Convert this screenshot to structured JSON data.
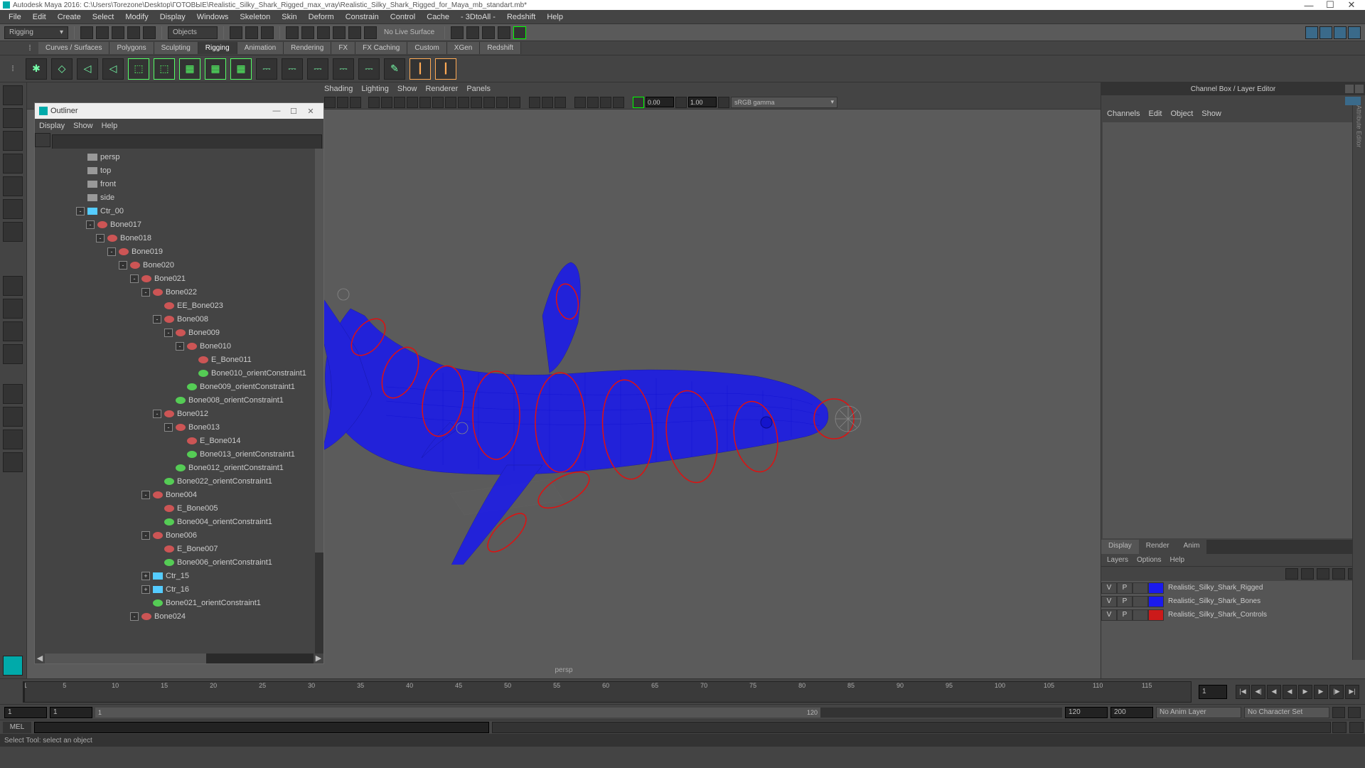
{
  "titlebar": {
    "text": "Autodesk Maya 2016: C:\\Users\\Torezone\\Desktop\\ГОТОВЫЕ\\Realistic_Silky_Shark_Rigged_max_vray\\Realistic_Silky_Shark_Rigged_for_Maya_mb_standart.mb*"
  },
  "mainmenu": [
    "File",
    "Edit",
    "Create",
    "Select",
    "Modify",
    "Display",
    "Windows",
    "Skeleton",
    "Skin",
    "Deform",
    "Constrain",
    "Control",
    "Cache",
    "- 3DtoAll -",
    "Redshift",
    "Help"
  ],
  "shelf": {
    "dropdown": "Rigging",
    "objectsLabel": "Objects",
    "noLiveSurface": "No Live Surface"
  },
  "tabs": [
    "Curves / Surfaces",
    "Polygons",
    "Sculpting",
    "Rigging",
    "Animation",
    "Rendering",
    "FX",
    "FX Caching",
    "Custom",
    "XGen",
    "Redshift"
  ],
  "activeTab": "Rigging",
  "outliner": {
    "title": "Outliner",
    "menu": [
      "Display",
      "Show",
      "Help"
    ],
    "tree": [
      {
        "ind": 0,
        "type": "cam",
        "label": "persp",
        "exp": false
      },
      {
        "ind": 0,
        "type": "cam",
        "label": "top",
        "exp": false
      },
      {
        "ind": 0,
        "type": "cam",
        "label": "front",
        "exp": false
      },
      {
        "ind": 0,
        "type": "cam",
        "label": "side",
        "exp": false
      },
      {
        "ind": 0,
        "type": "ctrl",
        "label": "Ctr_00",
        "exp": "-",
        "preExp": true
      },
      {
        "ind": 1,
        "type": "bone",
        "label": "Bone017",
        "exp": "-",
        "preExp": true
      },
      {
        "ind": 2,
        "type": "bone",
        "label": "Bone018",
        "exp": "-",
        "preExp": true
      },
      {
        "ind": 3,
        "type": "bone",
        "label": "Bone019",
        "exp": "-",
        "preExp": true
      },
      {
        "ind": 4,
        "type": "bone",
        "label": "Bone020",
        "exp": "-",
        "preExp": true
      },
      {
        "ind": 5,
        "type": "bone",
        "label": "Bone021",
        "exp": "-",
        "preExp": true
      },
      {
        "ind": 6,
        "type": "bone",
        "label": "Bone022",
        "exp": "-",
        "preExp": true
      },
      {
        "ind": 7,
        "type": "bone",
        "label": "EE_Bone023"
      },
      {
        "ind": 7,
        "type": "bone",
        "label": "Bone008",
        "exp": "-",
        "preExp": true
      },
      {
        "ind": 8,
        "type": "bone",
        "label": "Bone009",
        "exp": "-",
        "preExp": true
      },
      {
        "ind": 9,
        "type": "bone",
        "label": "Bone010",
        "exp": "-",
        "preExp": true
      },
      {
        "ind": 10,
        "type": "bone",
        "label": "E_Bone011"
      },
      {
        "ind": 10,
        "type": "constraint",
        "label": "Bone010_orientConstraint1"
      },
      {
        "ind": 9,
        "type": "constraint",
        "label": "Bone009_orientConstraint1"
      },
      {
        "ind": 8,
        "type": "constraint",
        "label": "Bone008_orientConstraint1"
      },
      {
        "ind": 7,
        "type": "bone",
        "label": "Bone012",
        "exp": "-",
        "preExp": true
      },
      {
        "ind": 8,
        "type": "bone",
        "label": "Bone013",
        "exp": "-",
        "preExp": true
      },
      {
        "ind": 9,
        "type": "bone",
        "label": "E_Bone014"
      },
      {
        "ind": 9,
        "type": "constraint",
        "label": "Bone013_orientConstraint1"
      },
      {
        "ind": 8,
        "type": "constraint",
        "label": "Bone012_orientConstraint1"
      },
      {
        "ind": 7,
        "type": "constraint",
        "label": "Bone022_orientConstraint1"
      },
      {
        "ind": 6,
        "type": "bone",
        "label": "Bone004",
        "exp": "-",
        "preExp": true
      },
      {
        "ind": 7,
        "type": "bone",
        "label": "E_Bone005"
      },
      {
        "ind": 7,
        "type": "constraint",
        "label": "Bone004_orientConstraint1"
      },
      {
        "ind": 6,
        "type": "bone",
        "label": "Bone006",
        "exp": "-",
        "preExp": true
      },
      {
        "ind": 7,
        "type": "bone",
        "label": "E_Bone007"
      },
      {
        "ind": 7,
        "type": "constraint",
        "label": "Bone006_orientConstraint1"
      },
      {
        "ind": 6,
        "type": "ctrl",
        "label": "Ctr_15",
        "exp": "+"
      },
      {
        "ind": 6,
        "type": "ctrl",
        "label": "Ctr_16",
        "exp": "+"
      },
      {
        "ind": 6,
        "type": "constraint",
        "label": "Bone021_orientConstraint1"
      },
      {
        "ind": 5,
        "type": "bone",
        "label": "Bone024",
        "exp": "-",
        "preExp": true
      }
    ]
  },
  "viewport": {
    "menu": [
      "Shading",
      "Lighting",
      "Show",
      "Renderer",
      "Panels"
    ],
    "val1": "0.00",
    "val2": "1.00",
    "colorspace": "sRGB gamma",
    "label": "persp"
  },
  "channelbox": {
    "title": "Channel Box / Layer Editor",
    "menu": [
      "Channels",
      "Edit",
      "Object",
      "Show"
    ],
    "tabs": [
      "Display",
      "Render",
      "Anim"
    ],
    "activeTab": "Display",
    "menu2": [
      "Layers",
      "Options",
      "Help"
    ],
    "layers": [
      {
        "v": "V",
        "p": "P",
        "color": "#1a1aee",
        "name": "Realistic_Silky_Shark_Rigged"
      },
      {
        "v": "V",
        "p": "P",
        "color": "#1a1aee",
        "name": "Realistic_Silky_Shark_Bones"
      },
      {
        "v": "V",
        "p": "P",
        "color": "#cc1a1a",
        "name": "Realistic_Silky_Shark_Controls"
      }
    ]
  },
  "timeline": {
    "ticks": [
      1,
      5,
      10,
      15,
      20,
      25,
      30,
      35,
      40,
      45,
      50,
      55,
      60,
      65,
      70,
      75,
      80,
      85,
      90,
      95,
      100,
      105,
      110,
      115
    ],
    "current": "1"
  },
  "range": {
    "start1": "1",
    "start2": "1",
    "sliderStart": "1",
    "sliderEnd": "120",
    "end1": "120",
    "end2": "200",
    "animLayer": "No Anim Layer",
    "charSet": "No Character Set"
  },
  "cmd": {
    "lang": "MEL"
  },
  "help": {
    "text": "Select Tool: select an object"
  }
}
